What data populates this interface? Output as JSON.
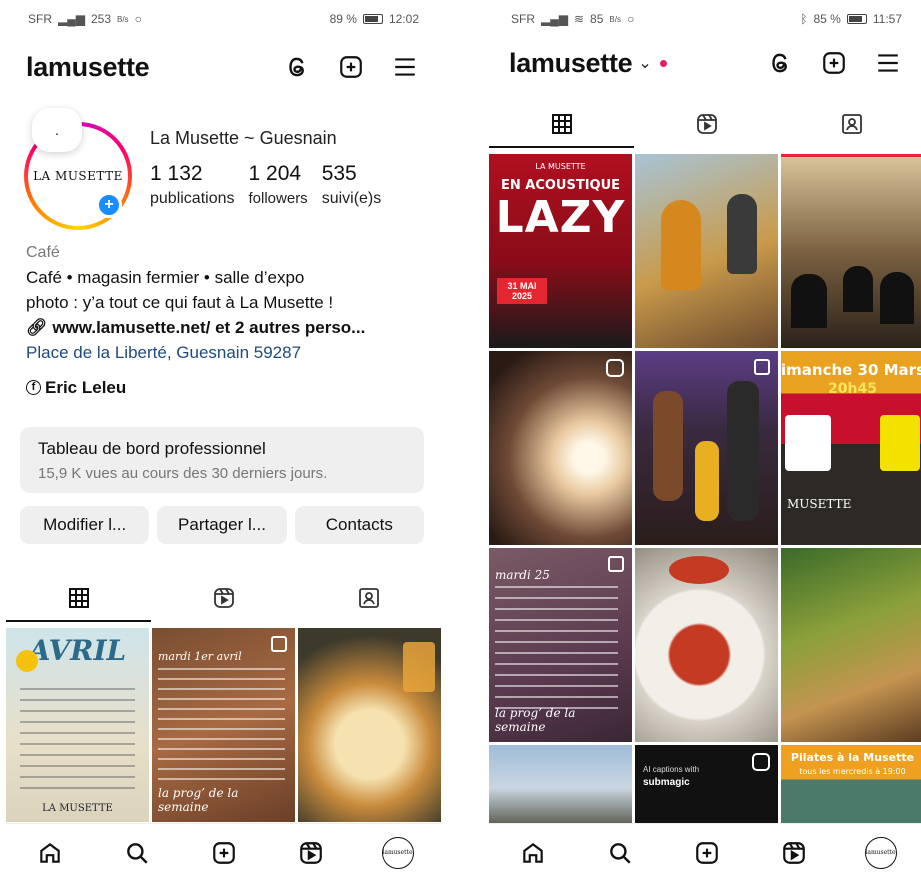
{
  "left": {
    "status": {
      "carrier": "SFR",
      "net": "253",
      "net_unit": "B/s",
      "battery": "89 %",
      "time": "12:02"
    },
    "username": "lamusette",
    "avatar_text": "LA MUSETTE",
    "bubble_text": ".",
    "display_name": "La Musette ~ Guesnain",
    "stats": [
      {
        "num": "1 132",
        "label": "publications"
      },
      {
        "num": "1 204",
        "label": "followers"
      },
      {
        "num": "535",
        "label": "suivi(e)s"
      }
    ],
    "bio": {
      "category": "Café",
      "line1": "Café • magasin fermier • salle d’expo",
      "line2": "photo : y’a tout ce qui faut à La Musette !",
      "link": "www.lamusette.net/ et 2 autres perso...",
      "location": "Place de la Liberté, Guesnain 59287",
      "facebook": "Eric Leleu"
    },
    "dashboard": {
      "title": "Tableau de bord professionnel",
      "subtitle": "15,9 K vues au cours des 30 derniers jours."
    },
    "buttons": [
      "Modifier l...",
      "Partager l...",
      "Contacts"
    ],
    "posts": [
      {
        "big": "AVRIL",
        "caption": "LA MUSETTE"
      },
      {
        "caption": "la prog’ de la semaine",
        "top": "mardi 1er avril"
      },
      {
        "caption": ""
      }
    ]
  },
  "right": {
    "status": {
      "carrier": "SFR",
      "net": "85",
      "net_unit": "B/s",
      "battery": "85 %",
      "time": "11:57"
    },
    "username": "lamusette",
    "posts": [
      {
        "top": "LA MUSETTE",
        "big": "EN ACOUSTIQUE",
        "big2": "LAZY",
        "caption": "31 MAI 2025"
      },
      {
        "caption": ""
      },
      {
        "caption": ""
      },
      {
        "caption": ""
      },
      {
        "caption": ""
      },
      {
        "big": "imanche 30 Mars",
        "big2": "20h45",
        "caption": "MUSETTE"
      },
      {
        "top": "mardi 25",
        "caption": "la prog’ de la semaine"
      },
      {
        "caption": ""
      },
      {
        "caption": ""
      },
      {
        "caption": ""
      },
      {
        "top": "AI captions with",
        "big": "submagic"
      },
      {
        "big": "Pilates à la Musette",
        "big2": "tous les mercredis à 19:00"
      }
    ]
  },
  "nav_avatar_text": "lamusette",
  "colors": {
    "accent_blue": "#1a8cff",
    "link_blue": "#1f4a7a",
    "notif_red": "#e0245e",
    "button_bg": "#efefef"
  }
}
